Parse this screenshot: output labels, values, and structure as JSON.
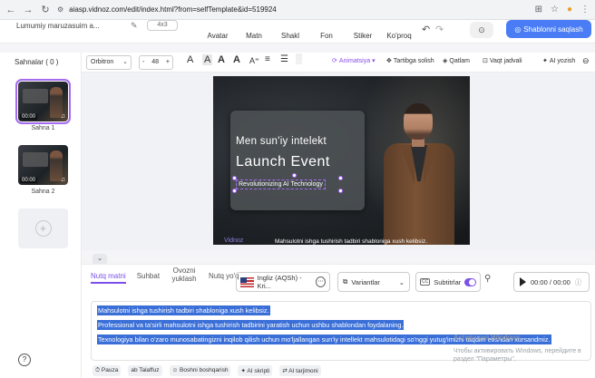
{
  "browser": {
    "url": "aiasp.vidnoz.com/edit/index.html?from=selfTemplate&id=519924"
  },
  "appbar": {
    "project_name": "Lumumiy maruzasuim a...",
    "project_pill": "4x3",
    "menu": [
      "Avatar",
      "Matn",
      "Shakl",
      "Fon",
      "Stiker",
      "Ko'proq"
    ],
    "generate_label": "Shablonni saqlash"
  },
  "sidebar": {
    "title": "Sahnalar ( 0 )",
    "scenes": [
      {
        "time": "00:00",
        "label": "Sahna 1"
      },
      {
        "time": "00:00",
        "label": "Sahna 2"
      }
    ]
  },
  "toolbar": {
    "font": "Orbitron",
    "size": "48",
    "minus": "-",
    "plus": "+",
    "animation_label": "Animatsiya",
    "arrange_label": "Tartibga solish",
    "layers_label": "Qatlam",
    "timeline_label": "Vaqt jadvali",
    "ai_label": "AI yozish"
  },
  "video": {
    "line1": "Men sun'iy intelekt",
    "line2": "Launch Event",
    "line3": "Revolutionizing AI Technology",
    "logo": "Vidnoz",
    "subtitle": "Mahsulotni ishga tushirish tadbiri shabloniga xush kelibsiz."
  },
  "panel": {
    "tabs": [
      "Nutq matni",
      "Suhbat",
      "Ovozni yuklash",
      "Nutq yo'q"
    ],
    "voice": "Ingliz (AQSh) - Kri...",
    "variants": "Variantlar",
    "subtitle": "Subtitrlar",
    "time": "00:00 / 00:00",
    "script_lines": [
      "Mahsulotni ishga tushirish tadbiri shabloniga xush kelibsiz.",
      "Professional va ta'sirli mahsulotni ishga tushirish tadbirini yaratish uchun ushbu shablondan foydalaning.",
      "Texnologiya bilan o'zaro munosabatingizni inqilob qilish uchun mo'ljallangan sun'iy intellekt mahsulotidagi so'nggi yutug'imizni taqdim etishdan xursandmiz."
    ],
    "tools": [
      "Pauza",
      "Talaffuz",
      "Boshni boshqarish",
      "AI skripti",
      "AI tarjimoni"
    ]
  },
  "watermark": {
    "line1": "Активация Windows",
    "line2": "Чтобы активировать Windows, перейдите в раздел \"Параметры\"."
  }
}
